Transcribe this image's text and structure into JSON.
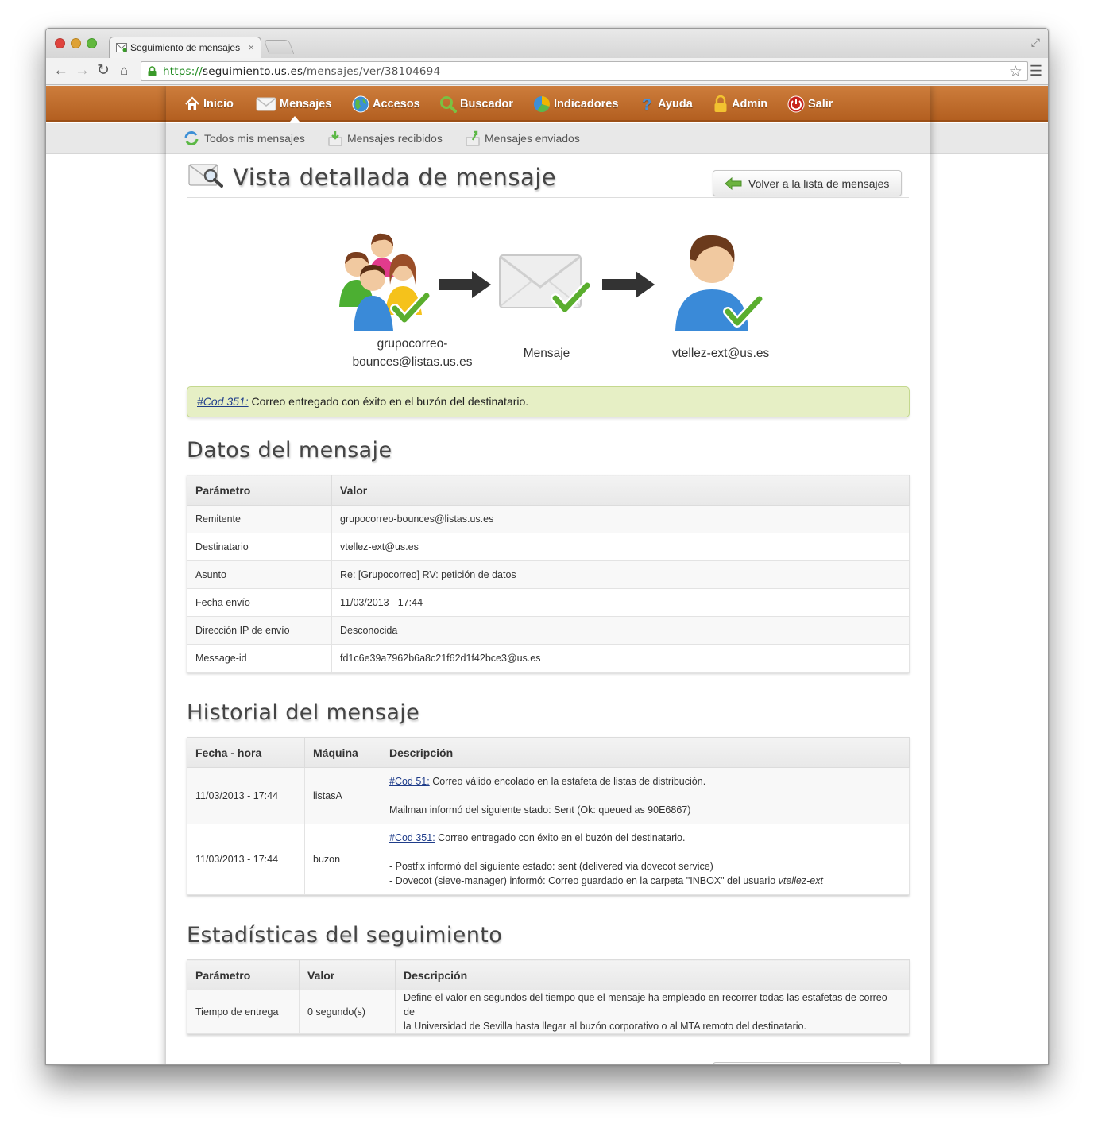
{
  "browser": {
    "tab_title": "Seguimiento de mensajes",
    "tab_close": "×",
    "url_scheme": "https://",
    "url_host": "seguimiento.us.es",
    "url_path": "/mensajes/ver/38104694"
  },
  "topnav": {
    "items": [
      {
        "label": "Inicio",
        "icon": "home-icon"
      },
      {
        "label": "Mensajes",
        "icon": "envelope-icon",
        "active": true
      },
      {
        "label": "Accesos",
        "icon": "globe-icon"
      },
      {
        "label": "Buscador",
        "icon": "magnifier-icon"
      },
      {
        "label": "Indicadores",
        "icon": "pie-chart-icon"
      },
      {
        "label": "Ayuda",
        "icon": "help-icon"
      },
      {
        "label": "Admin",
        "icon": "lock-icon"
      },
      {
        "label": "Salir",
        "icon": "power-icon"
      }
    ]
  },
  "subnav": {
    "items": [
      {
        "label": "Todos mis mensajes",
        "icon": "refresh-icon"
      },
      {
        "label": "Mensajes recibidos",
        "icon": "inbox-download-icon"
      },
      {
        "label": "Mensajes enviados",
        "icon": "outbox-upload-icon"
      }
    ]
  },
  "page": {
    "title": "Vista detallada de mensaje",
    "back_button": "Volver a la lista de mensajes"
  },
  "flow": {
    "sender_line1": "grupocorreo-",
    "sender_line2": "bounces@listas.us.es",
    "message": "Mensaje",
    "recipient": "vtellez-ext@us.es"
  },
  "alert": {
    "code": "#Cod 351:",
    "text": " Correo entregado con éxito en el buzón del destinatario."
  },
  "datos": {
    "title": "Datos del mensaje",
    "headers": [
      "Parámetro",
      "Valor"
    ],
    "rows": [
      [
        "Remitente",
        "grupocorreo-bounces@listas.us.es"
      ],
      [
        "Destinatario",
        "vtellez-ext@us.es"
      ],
      [
        "Asunto",
        "Re: [Grupocorreo] RV: petición de datos"
      ],
      [
        "Fecha envío",
        "11/03/2013 - 17:44"
      ],
      [
        "Dirección IP de envío",
        "Desconocida"
      ],
      [
        "Message-id",
        "fd1c6e39a7962b6a8c21f62d1f42bce3@us.es"
      ]
    ]
  },
  "historial": {
    "title": "Historial del mensaje",
    "headers": [
      "Fecha - hora",
      "Máquina",
      "Descripción"
    ],
    "rows": [
      {
        "fecha": "11/03/2013 - 17:44",
        "maquina": "listasA",
        "code": "#Cod 51:",
        "code_text": " Correo válido encolado en la estafeta de listas de distribución.",
        "line2": "Mailman informó del siguiente stado: Sent (Ok: queued as 90E6867)"
      },
      {
        "fecha": "11/03/2013 - 17:44",
        "maquina": "buzon",
        "code": "#Cod 351:",
        "code_text": " Correo entregado con éxito en el buzón del destinatario.",
        "line2": "- Postfix informó del siguiente estado: sent (delivered via dovecot service)",
        "line3": "- Dovecot (sieve-manager) informó: Correo guardado en la carpeta \"INBOX\" del usuario ",
        "line3_user": "vtellez-ext"
      }
    ]
  },
  "estadisticas": {
    "title": "Estadísticas del seguimiento",
    "headers": [
      "Parámetro",
      "Valor",
      "Descripción"
    ],
    "rows": [
      {
        "parametro": "Tiempo de entrega",
        "valor": "0 segundo(s)",
        "descripcion_1": "Define el valor en segundos del tiempo que el mensaje ha empleado en recorrer todas las estafetas de correo de",
        "descripcion_2": "la Universidad de Sevilla hasta llegar al buzón corporativo o al MTA remoto del destinatario."
      }
    ]
  },
  "colors": {
    "nav_orange": "#c06a2a",
    "alert_green": "#e6efc5",
    "link_blue": "#1f3d8a"
  }
}
